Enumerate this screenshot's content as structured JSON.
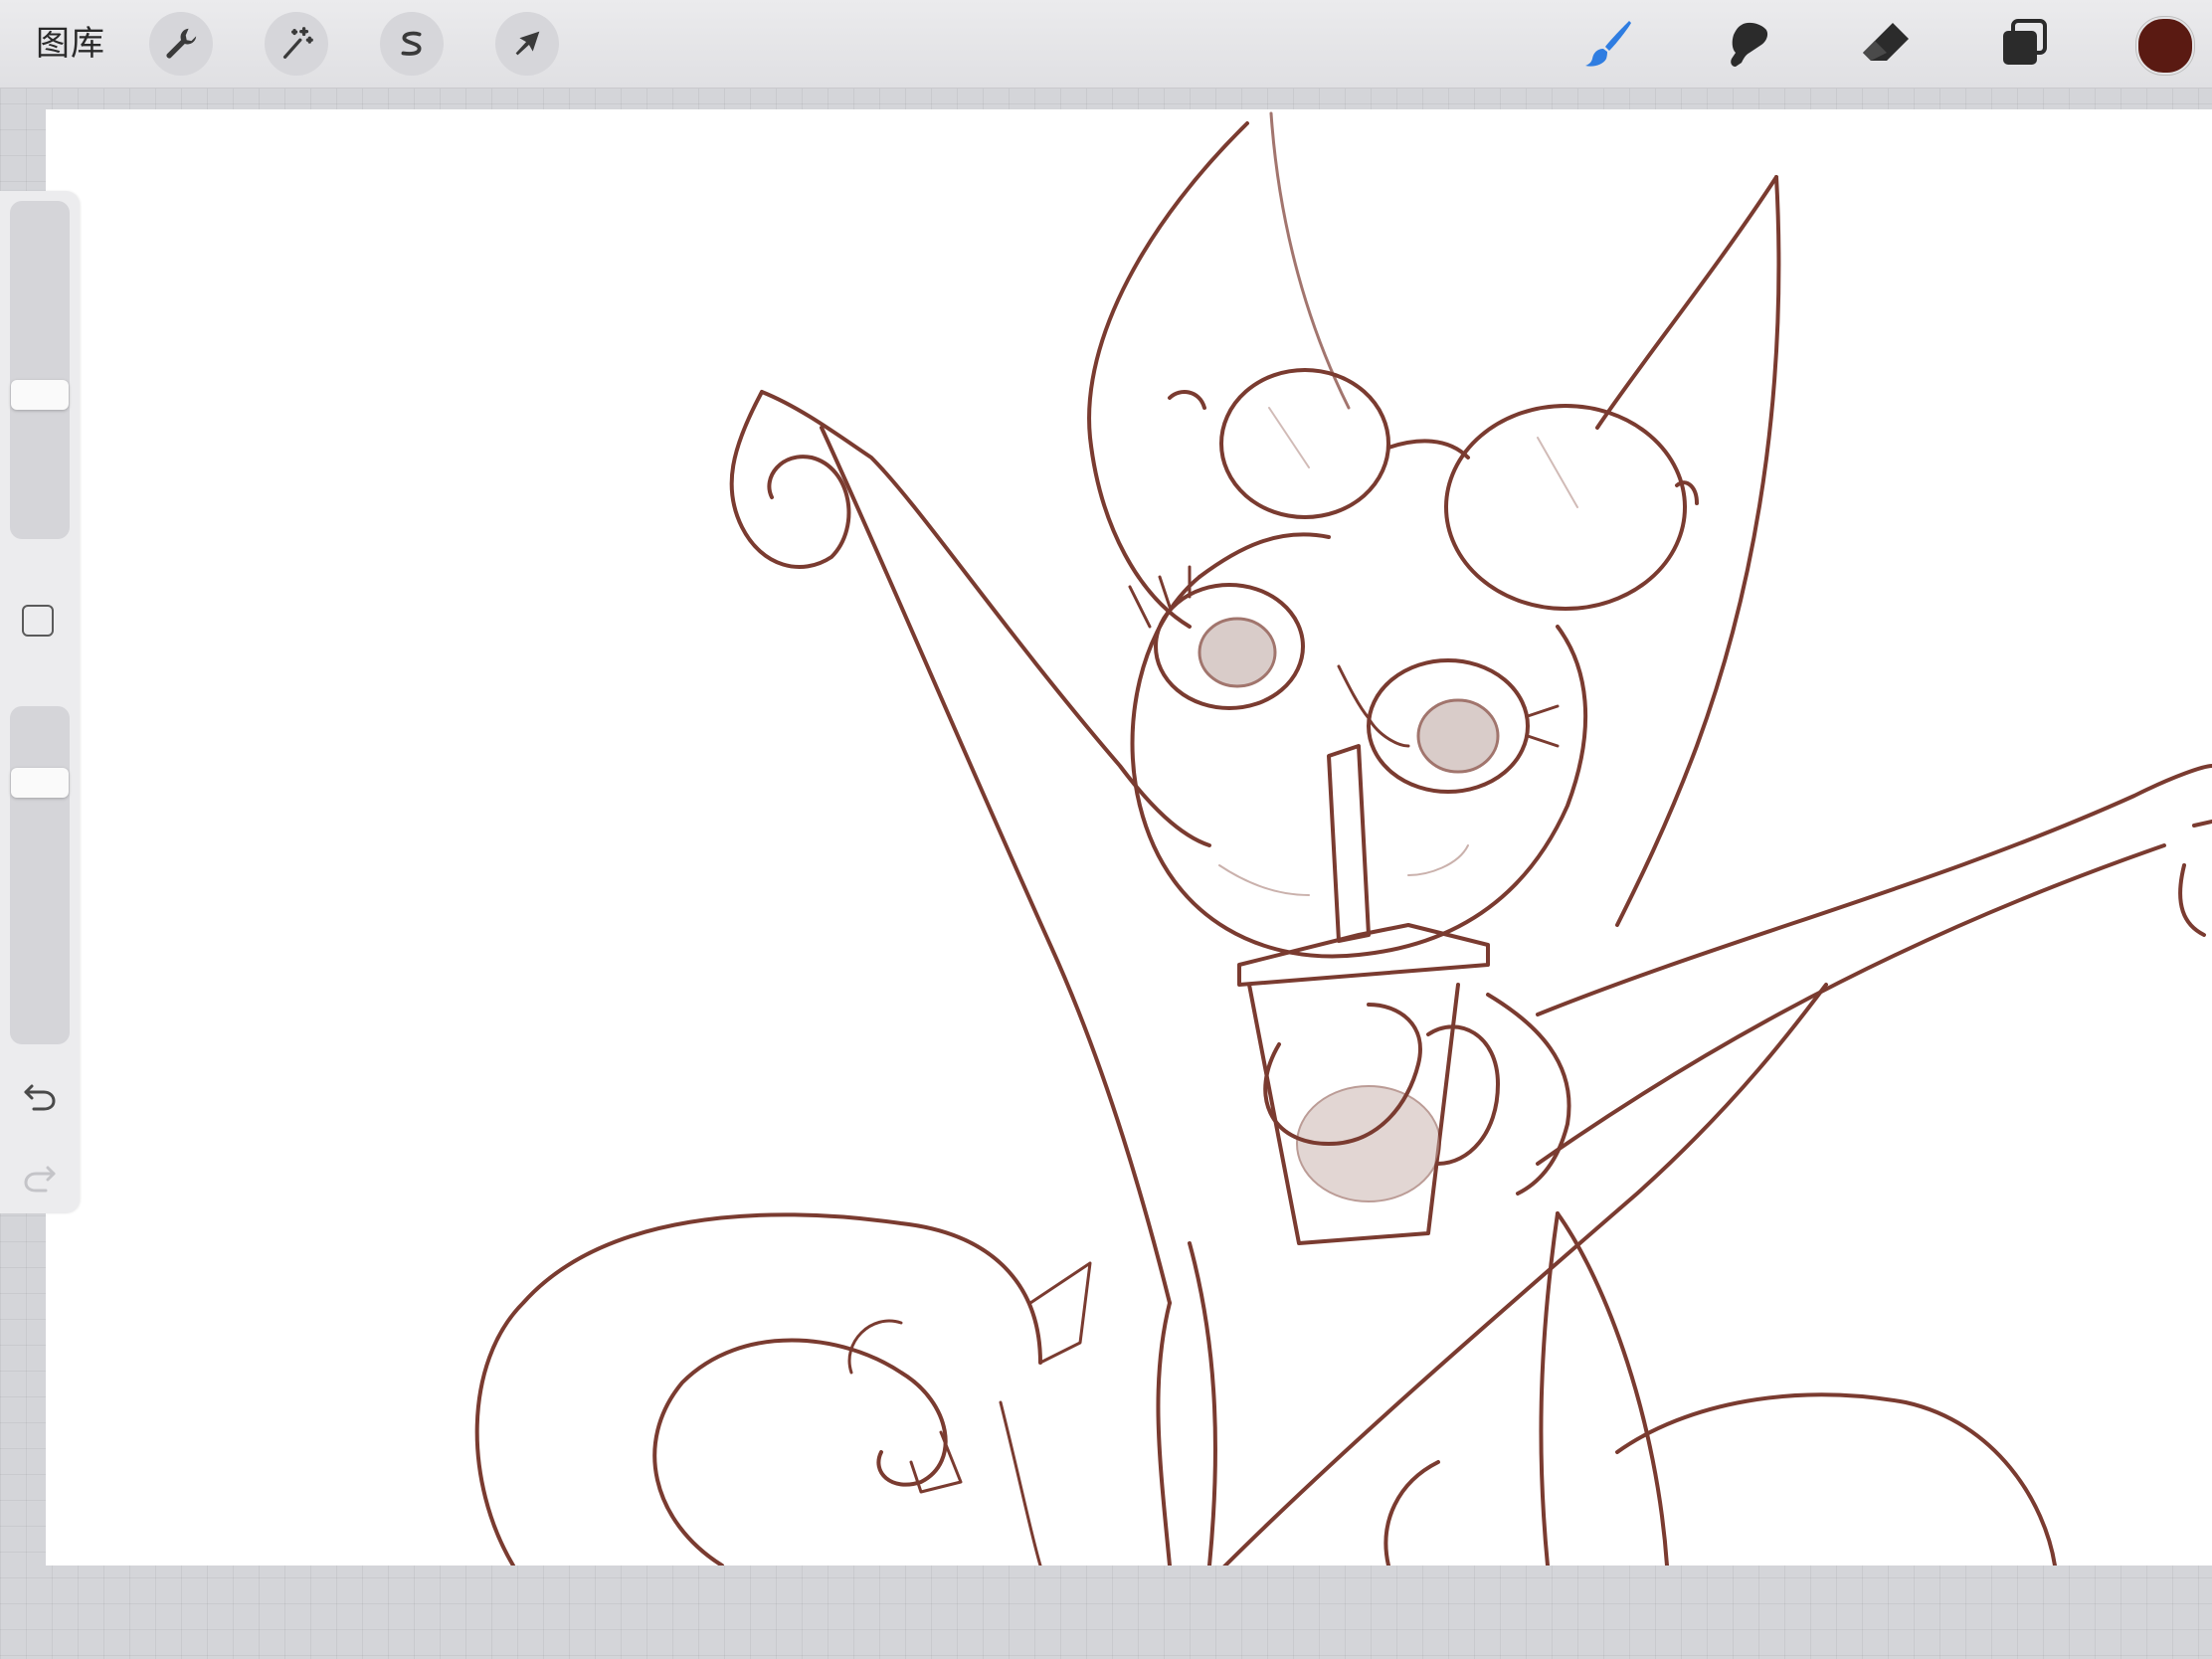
{
  "toolbar": {
    "gallery_label": "图库",
    "left_tools": [
      {
        "name": "actions",
        "icon": "wrench-icon"
      },
      {
        "name": "adjustments",
        "icon": "magic-wand-icon"
      },
      {
        "name": "selection",
        "icon": "selection-s-icon"
      },
      {
        "name": "transform",
        "icon": "arrow-cursor-icon"
      }
    ],
    "right_tools": [
      {
        "name": "brush",
        "icon": "paintbrush-icon",
        "active": true
      },
      {
        "name": "smudge",
        "icon": "smudge-finger-icon",
        "active": false
      },
      {
        "name": "eraser",
        "icon": "eraser-icon",
        "active": false
      },
      {
        "name": "layers",
        "icon": "layers-icon",
        "active": false
      }
    ],
    "current_color": "#5a1a12",
    "active_tool_color": "#2f7de1"
  },
  "sidebar": {
    "brush_size_level": 0.42,
    "brush_opacity_level": 0.8,
    "modify_icon": "square-icon",
    "undo_icon": "undo-icon",
    "redo_icon": "redo-icon",
    "redo_enabled": false
  },
  "canvas": {
    "content": "sketch-artwork",
    "stroke_color": "#7a3b30"
  }
}
